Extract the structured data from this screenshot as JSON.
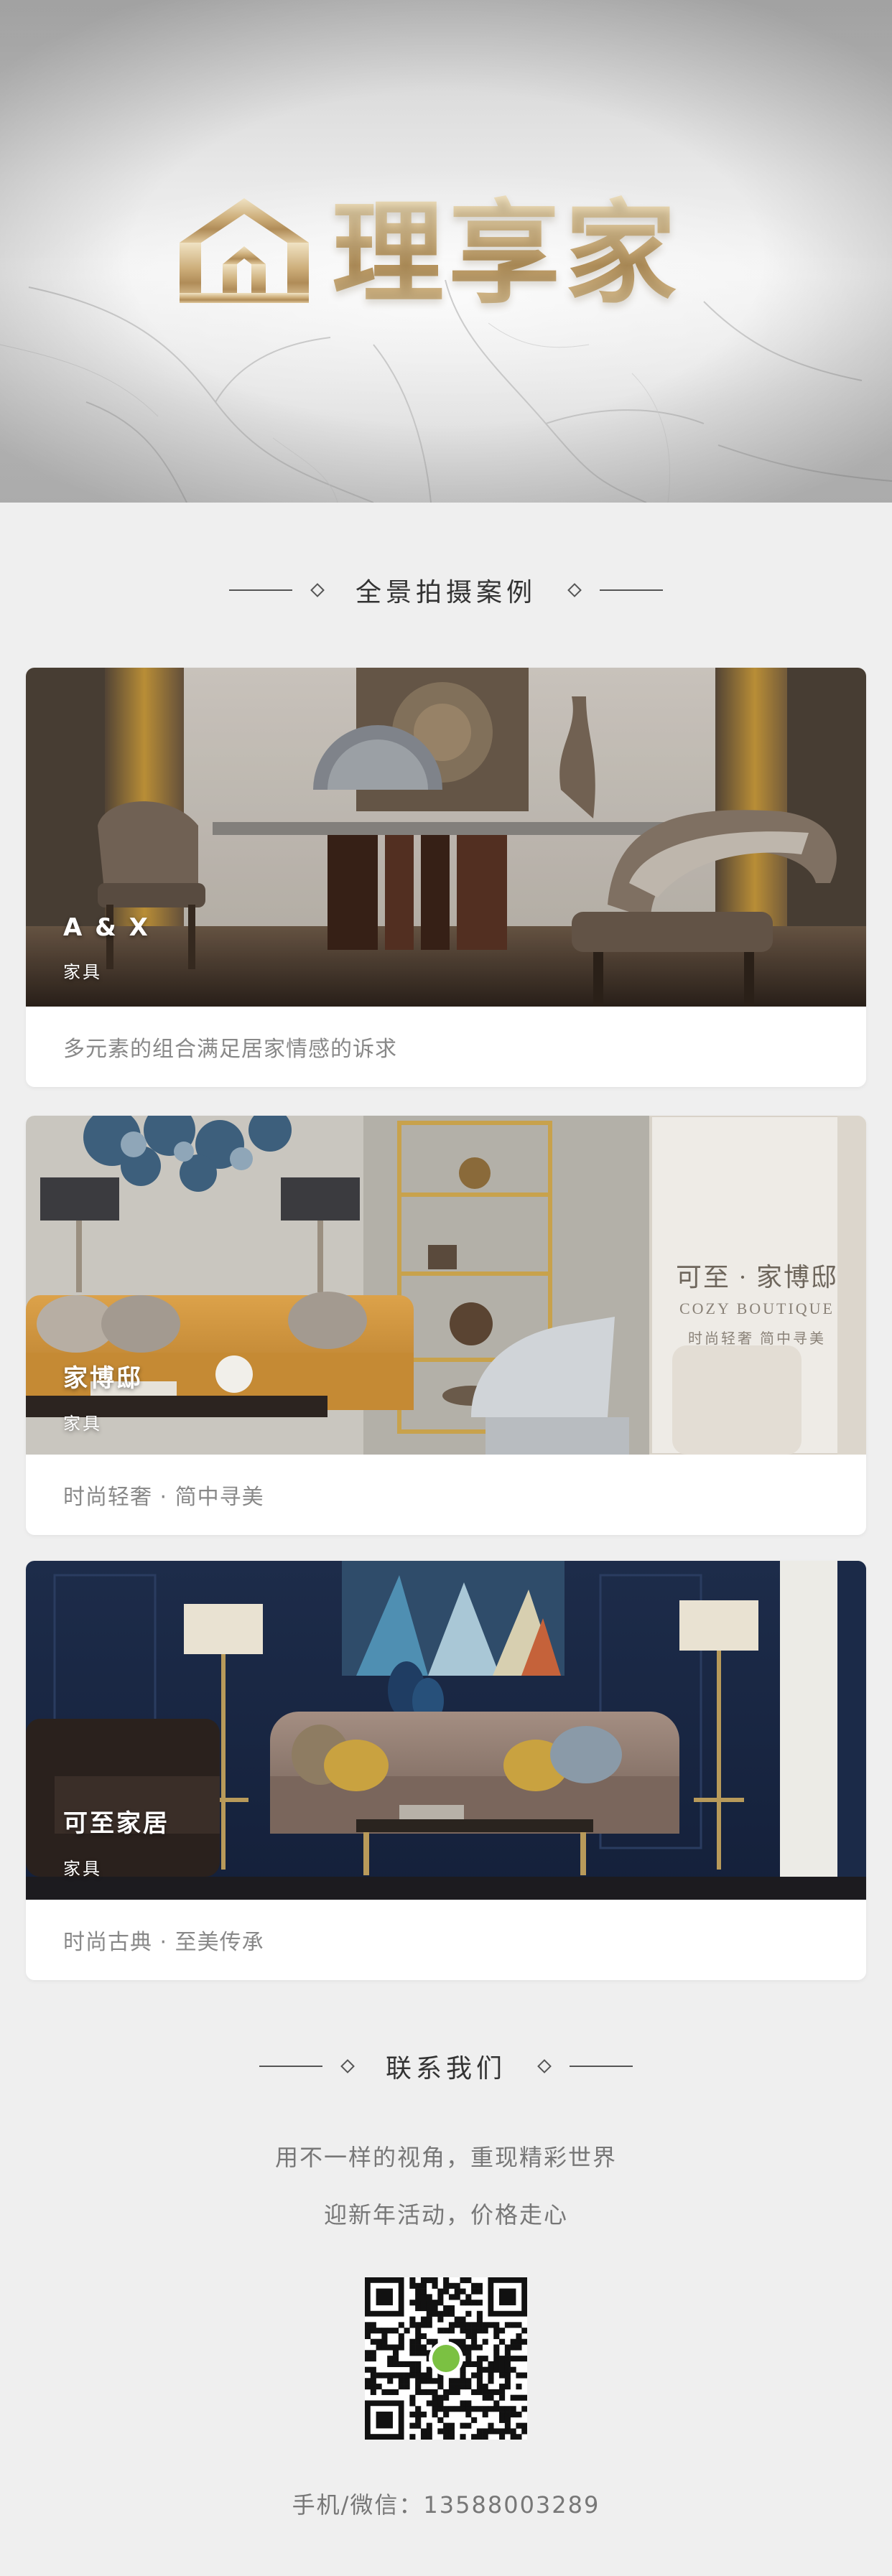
{
  "header": {
    "brand_name": "理享家"
  },
  "cases_section": {
    "title": "全景拍摄案例"
  },
  "cases": [
    {
      "brand": "A & X",
      "type": "家具",
      "caption": "多元素的组合满足居家情感的诉求"
    },
    {
      "brand": "家博邸",
      "type": "家具",
      "caption": "时尚轻奢 · 简中寻美",
      "inset_title": "可至 · 家博邸",
      "inset_en": "COZY BOUTIQUE",
      "inset_slogan": "时尚轻奢 简中寻美"
    },
    {
      "brand": "可至家居",
      "type": "家具",
      "caption": "时尚古典 · 至美传承"
    }
  ],
  "contact_section": {
    "title": "联系我们",
    "line1": "用不一样的视角，重现精彩世界",
    "line2": "迎新年活动，价格走心",
    "phone": "手机/微信：13588003289"
  },
  "colors": {
    "background": "#efefef",
    "gold": "#c8a872",
    "card": "#ffffff"
  }
}
